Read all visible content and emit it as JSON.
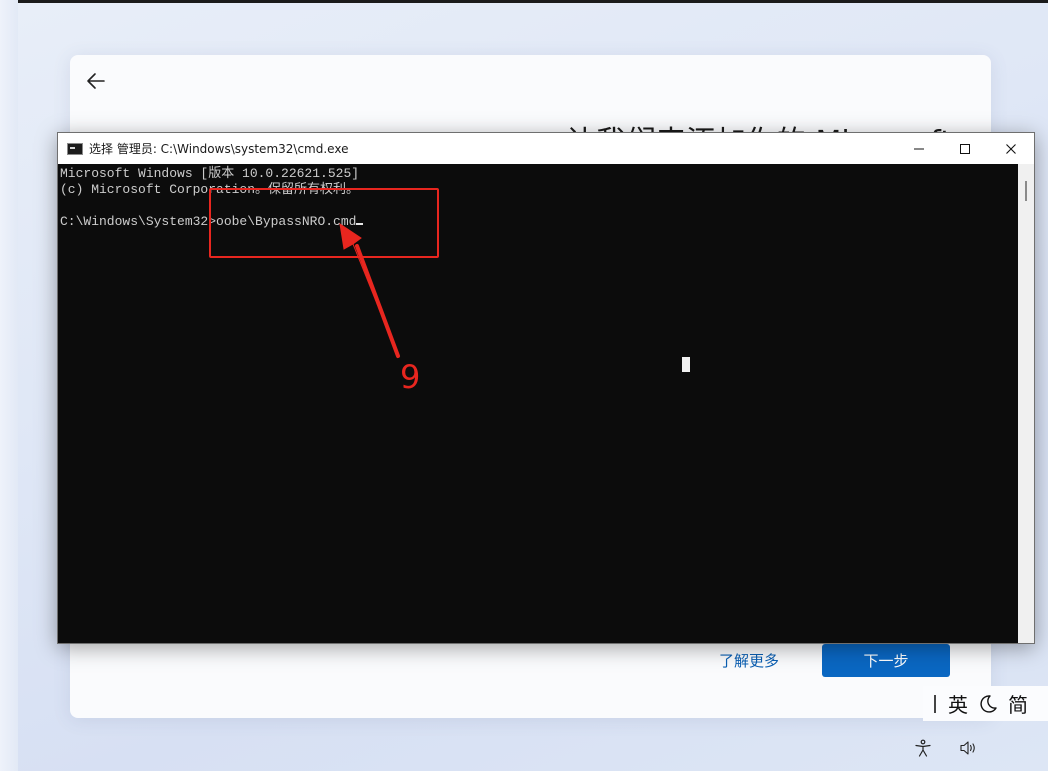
{
  "oobe": {
    "title": "让我们来添加你的 Microsoft",
    "learn_more": "了解更多",
    "next_button": "下一步"
  },
  "cmd": {
    "window_title": "选择 管理员: C:\\Windows\\system32\\cmd.exe",
    "lines": [
      "Microsoft Windows [版本 10.0.22621.525]",
      "(c) Microsoft Corporation。保留所有权利。",
      "",
      "C:\\Windows\\System32>oobe\\BypassNRO.cmd"
    ]
  },
  "annotation": {
    "step_number": "9",
    "color": "#e8261f"
  },
  "ime": {
    "language": "英",
    "mode": "简"
  },
  "icons": {
    "back": "back-arrow-icon",
    "minimize": "minimize-icon",
    "maximize": "maximize-icon",
    "close": "close-icon",
    "moon": "moon-icon",
    "accessibility": "accessibility-icon",
    "volume": "volume-icon"
  },
  "colors": {
    "accent": "#0a67c2",
    "link": "#0a5fb3",
    "console_bg": "#0c0c0c",
    "console_text": "#cccccc"
  }
}
